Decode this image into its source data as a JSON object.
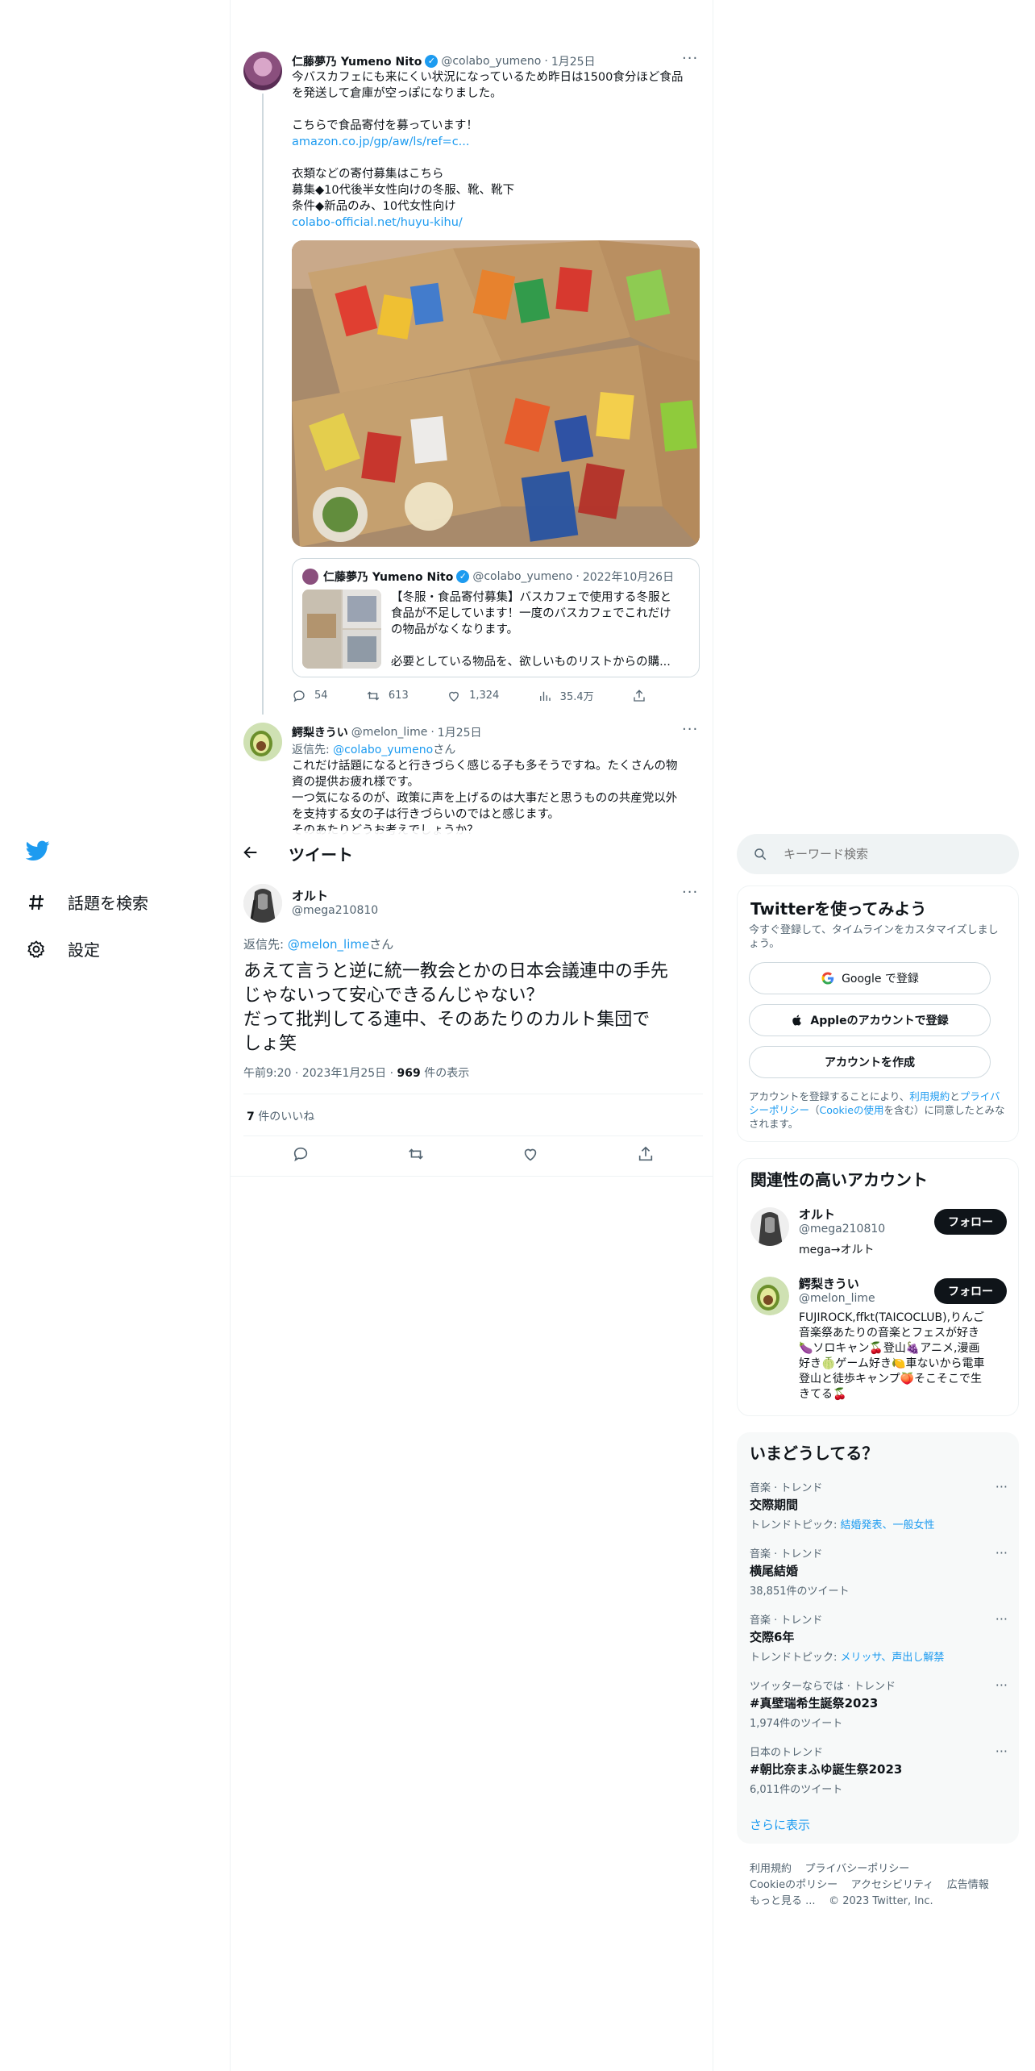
{
  "nav": {
    "explore_label": "話題を検索",
    "settings_label": "設定"
  },
  "background_tweet": {
    "name": "仁藤夢乃 Yumeno Nito",
    "handle": "@colabo_yumeno",
    "sep": "·",
    "date": "1月25日",
    "lines": [
      "今バスカフェにも来にくい状況になっているため昨日は1500食分ほど食品",
      "を発送して倉庫が空っぽになりました。",
      "",
      "こちらで食品寄付を募っています！"
    ],
    "link1": "amazon.co.jp/gp/aw/ls/ref=c...",
    "lines2": [
      "衣類などの寄付募集はこちら",
      "募集◆10代後半女性向けの冬服、靴、靴下",
      "条件◆新品のみ、10代女性向け"
    ],
    "link2": "colabo-official.net/huyu-kihu/",
    "quote": {
      "name": "仁藤夢乃 Yumeno Nito",
      "handle": "@colabo_yumeno",
      "sep": "·",
      "date": "2022年10月26日",
      "lines": [
        "【冬服・食品寄付募集】バスカフェで使用する冬服と",
        "食品が不足しています！一度のバスカフェでこれだけ",
        "の物品がなくなります。",
        "",
        "必要としている物品を、欲しいものリストからの購..."
      ]
    },
    "stats": {
      "replies": "54",
      "retweets": "613",
      "likes": "1,324",
      "views": "35.4万"
    }
  },
  "reply_tweet": {
    "name": "鰐梨きうい",
    "handle": "@melon_lime",
    "sep": "·",
    "date": "1月25日",
    "reply_prefix": "返信先: ",
    "reply_to": "@colabo_yumeno",
    "reply_suffix": "さん",
    "lines": [
      "これだけ話題になると行きづらく感じる子も多そうですね。たくさんの物",
      "資の提供お疲れ様です。",
      "一つ気になるのが、政策に声を上げるのは大事だと思うものの共産党以外",
      "を支持する女の子は行きづらいのではと感じます。",
      "そのあたりどうお考えでしょうか？"
    ]
  },
  "header": {
    "title": "ツイート"
  },
  "main_tweet": {
    "name": "オルト",
    "handle": "@mega210810",
    "reply_prefix": "返信先: ",
    "reply_to": "@melon_lime",
    "reply_suffix": "さん",
    "lines": [
      "あえて言うと逆に統一教会とかの日本会議連中の手先",
      "じゃないって安心できるんじゃない？",
      "だって批判してる連中、そのあたりのカルト集団で",
      "しょ笑"
    ],
    "time": "午前9:20",
    "sep": "·",
    "date": "2023年1月25日",
    "views_count": "969",
    "views_label": " 件の表示",
    "likes_count": "7",
    "likes_label": " 件のいいね"
  },
  "search": {
    "placeholder": "キーワード検索"
  },
  "signup": {
    "title": "Twitterを使ってみよう",
    "desc": "今すぐ登録して、タイムラインをカスタマイズしましょう。",
    "google": "Google で登録",
    "apple": "Appleのアカウントで登録",
    "create": "アカウントを作成",
    "legal_1": "アカウントを登録することにより、",
    "legal_terms": "利用規約",
    "legal_2": "と",
    "legal_privacy": "プライバシーポリシー",
    "legal_3": "（",
    "legal_cookie": "Cookieの使用",
    "legal_4": "を含む）に同意したとみなされます。"
  },
  "related": {
    "title": "関連性の高いアカウント",
    "follow_label": "フォロー",
    "accounts": [
      {
        "name": "オルト",
        "handle": "@mega210810",
        "bio": "mega→オルト"
      },
      {
        "name": "鰐梨きうい",
        "handle": "@melon_lime",
        "bio_lines": [
          "FUJIROCK,ffkt(TAICOCLUB),りんご",
          "音楽祭あたりの音楽とフェスが好き",
          "🍆ソロキャン🍒登山🍇アニメ,漫画",
          "好き🍈ゲーム好き🍋車ないから電車",
          "登山と徒歩キャンプ🍑そこそこで生",
          "きてる🍒"
        ]
      }
    ]
  },
  "trends": {
    "title": "いまどうしてる？",
    "items": [
      {
        "category": "音楽 · トレンド",
        "name": "交際期間",
        "sub_prefix": "トレンドトピック: ",
        "sub_link": "結婚発表、一般女性"
      },
      {
        "category": "音楽 · トレンド",
        "name": "横尾結婚",
        "sub": "38,851件のツイート"
      },
      {
        "category": "音楽 · トレンド",
        "name": "交際6年",
        "sub_prefix": "トレンドトピック: ",
        "sub_link": "メリッサ、声出し解禁"
      },
      {
        "category": "ツイッターならでは · トレンド",
        "name": "#真壁瑞希生誕祭2023",
        "sub": "1,974件のツイート"
      },
      {
        "category": "日本のトレンド",
        "name": "#朝比奈まふゆ誕生祭2023",
        "sub": "6,011件のツイート"
      }
    ],
    "show_more": "さらに表示"
  },
  "footer": {
    "line1": [
      "利用規約",
      "プライバシーポリシー"
    ],
    "line2": [
      "Cookieのポリシー",
      "アクセシビリティ",
      "広告情報"
    ],
    "more": "もっと見る ...",
    "copyright": "© 2023 Twitter, Inc."
  },
  "colors": {
    "accent": "#1d9bf0",
    "text": "#0f1419",
    "muted": "#536471",
    "panel": "#f7f9f9",
    "border": "#eff3f4"
  }
}
